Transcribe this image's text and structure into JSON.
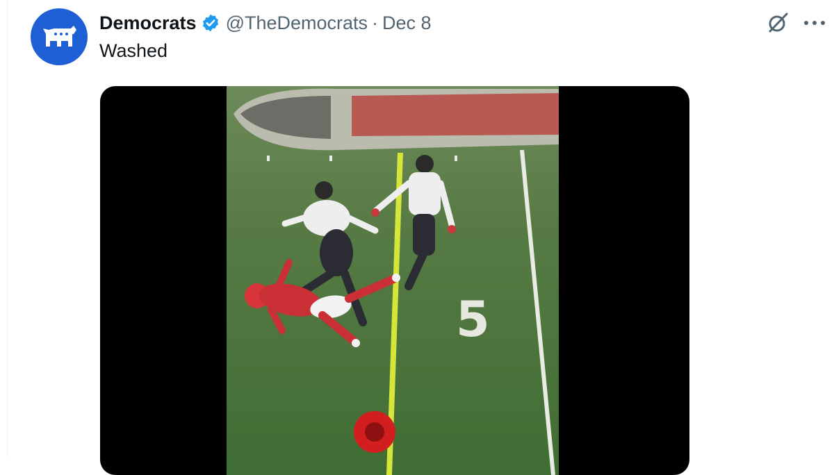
{
  "tweet": {
    "display_name": "Democrats",
    "handle": "@TheDemocrats",
    "separator": "·",
    "date": "Dec 8",
    "text": "Washed"
  },
  "icons": {
    "avatar": "donkey-logo",
    "verified": "verified-badge-icon",
    "grok": "grok-icon",
    "more": "more-icon"
  },
  "colors": {
    "brand_blue": "#1f5fd6",
    "verified_blue": "#1d9bf0",
    "muted_text": "#536471"
  },
  "media": {
    "field_number": "5"
  }
}
